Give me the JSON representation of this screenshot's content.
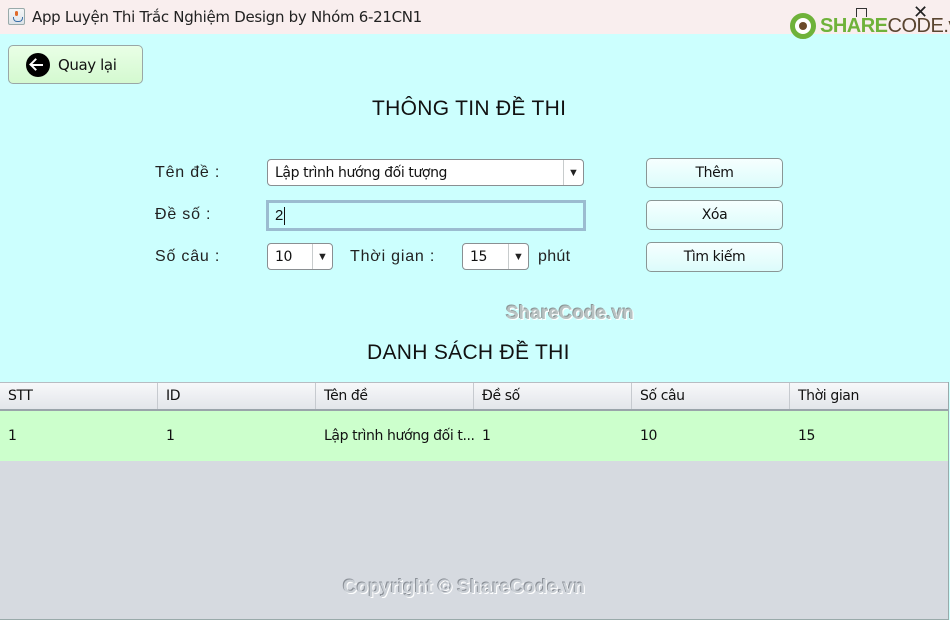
{
  "window": {
    "title": "App Luyện Thi Trắc Nghiệm Design by Nhóm 6-21CN1",
    "app_icon": "java-icon",
    "controls": [
      "maximize-icon",
      "close-icon"
    ],
    "close_glyph": "✕"
  },
  "brand": {
    "part1": "SHARE",
    "part2": "CODE",
    "part3": ".vn"
  },
  "back_button": {
    "label": "Quay lại",
    "icon": "arrow-left-circle-icon"
  },
  "info_section": {
    "title": "THÔNG TIN ĐỀ THI",
    "ten_de": {
      "label": "Tên đề :",
      "selected": "Lập trình hướng đối tượng"
    },
    "de_so": {
      "label": "Đề số :",
      "value": "2"
    },
    "so_cau": {
      "label": "Số câu :",
      "selected": "10"
    },
    "thoi_gian": {
      "label": "Thời gian :",
      "selected": "15",
      "unit": "phút"
    },
    "dropdown_glyph": "▼",
    "buttons": {
      "add": "Thêm",
      "delete": "Xóa",
      "search": "Tìm kiếm"
    }
  },
  "watermark_top": "ShareCode.vn",
  "list_section": {
    "title": "DANH SÁCH ĐỀ THI",
    "columns": [
      "STT",
      "ID",
      "Tên đề",
      "Đề số",
      "Số câu",
      "Thời gian"
    ],
    "rows": [
      [
        "1",
        "1",
        "Lập trình hướng đối t...",
        "1",
        "10",
        "15"
      ]
    ]
  },
  "watermark_bottom": "Copyright © ShareCode.vn",
  "colors": {
    "background": "#ccfffe",
    "titlebar": "#f9eeee",
    "selected_row": "#ccffcc",
    "table_empty": "#d6dae0",
    "brand_green": "#6fb23a"
  }
}
